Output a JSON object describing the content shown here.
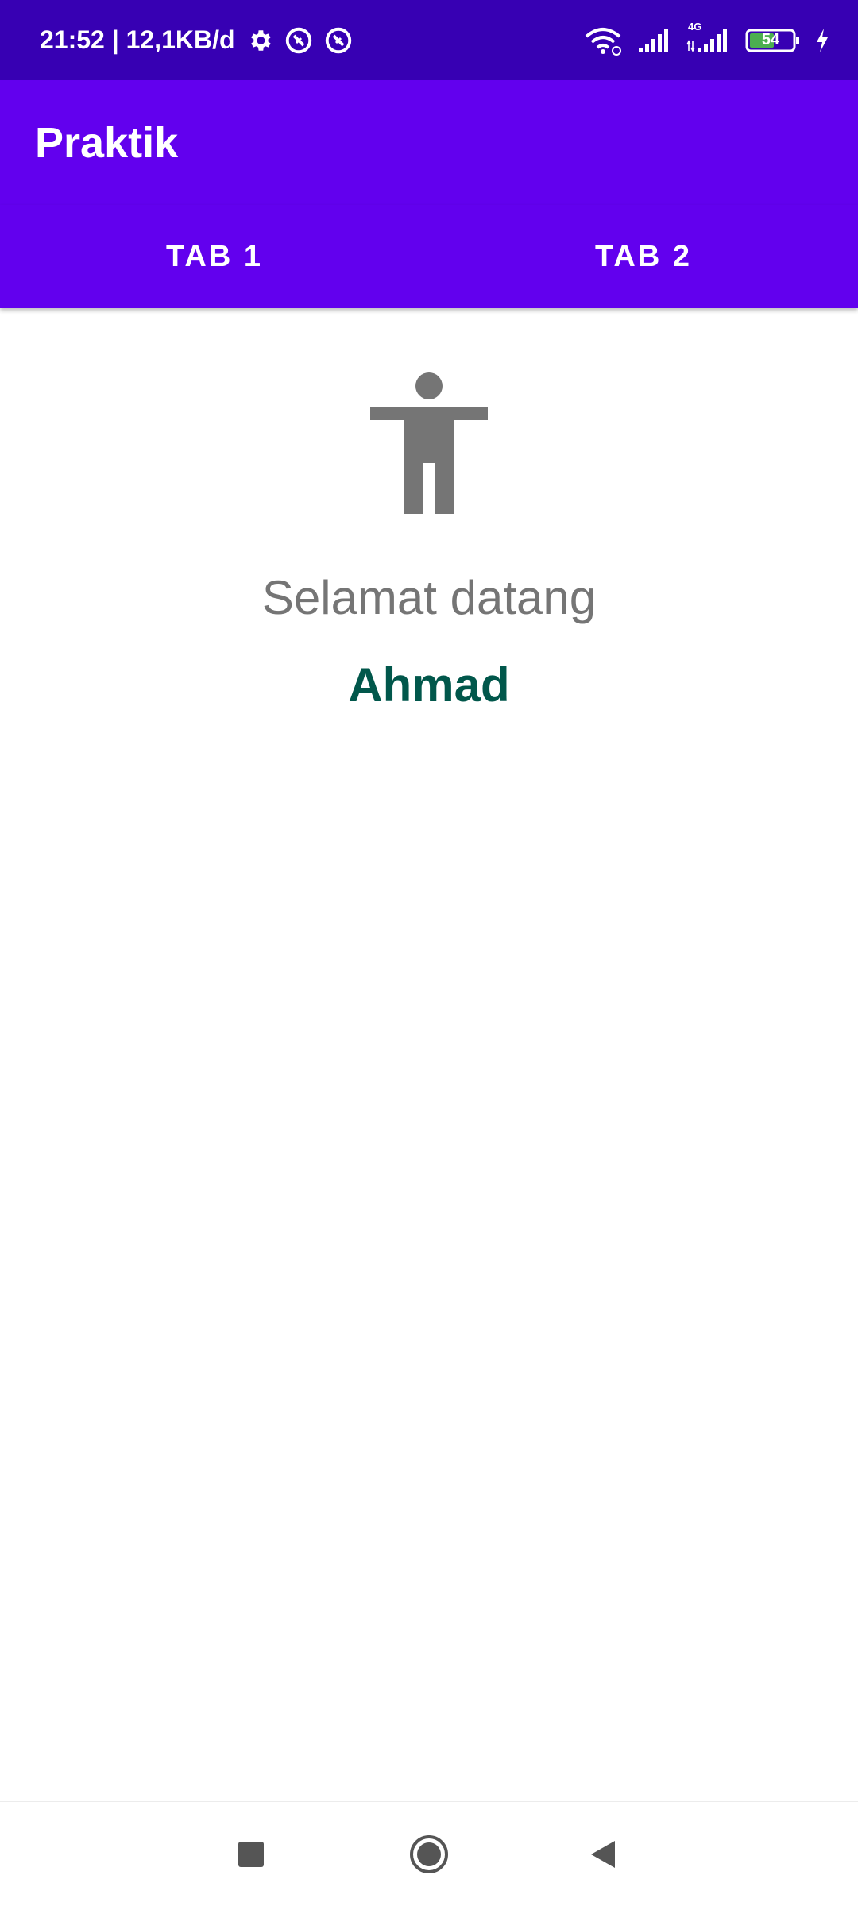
{
  "status_bar": {
    "time_and_speed": "21:52 | 12,1KB/d",
    "network_label": "4G",
    "battery_level": "54",
    "background_color": "#3700b3",
    "battery_color": "#4caf50"
  },
  "app_bar": {
    "title": "Praktik",
    "color": "#6200ee"
  },
  "tabs": [
    {
      "label": "TAB 1"
    },
    {
      "label": "TAB 2"
    }
  ],
  "content": {
    "icon": "accessibility-icon",
    "greeting": "Selamat datang",
    "user_name": "Ahmad",
    "greeting_color": "#757575",
    "name_color": "#01574b"
  },
  "nav_bar": {
    "buttons": [
      "recents-icon",
      "home-icon",
      "back-icon"
    ]
  }
}
